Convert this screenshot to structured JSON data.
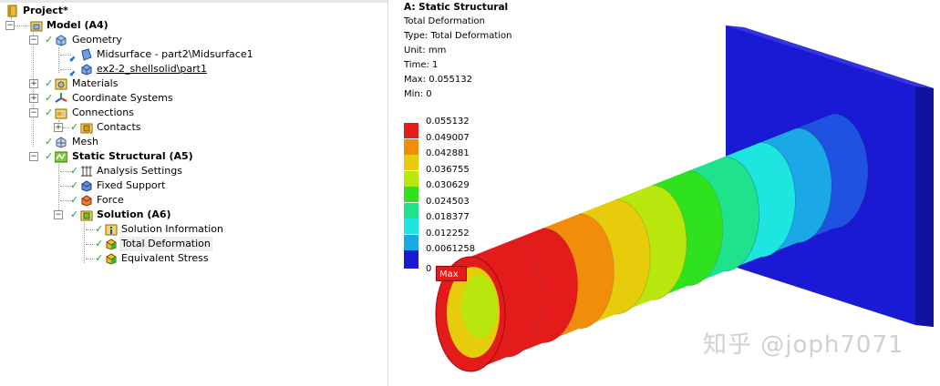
{
  "tree": {
    "project": "Project*",
    "model": "Model (A4)",
    "geometry": "Geometry",
    "midsurface": "Midsurface - part2\\Midsurface1",
    "part": "ex2-2_shellsolid\\part1",
    "materials": "Materials",
    "coordinate_systems": "Coordinate Systems",
    "connections": "Connections",
    "contacts": "Contacts",
    "mesh": "Mesh",
    "static_structural": "Static Structural (A5)",
    "analysis_settings": "Analysis Settings",
    "fixed_support": "Fixed Support",
    "force": "Force",
    "solution": "Solution (A6)",
    "solution_information": "Solution Information",
    "total_deformation": "Total Deformation",
    "equivalent_stress": "Equivalent Stress",
    "expander_plus": "+",
    "expander_minus": "−",
    "check": "✓"
  },
  "info": {
    "title": "A: Static Structural",
    "result": "Total Deformation",
    "type": "Type: Total Deformation",
    "unit": "Unit: mm",
    "time": "Time: 1",
    "max": "Max: 0.055132",
    "min": "Min: 0"
  },
  "legend": {
    "values": [
      "0.055132",
      "0.049007",
      "0.042881",
      "0.036755",
      "0.030629",
      "0.024503",
      "0.018377",
      "0.012252",
      "0.0061258",
      "0"
    ],
    "colors": [
      "#e41b1b",
      "#f28d0c",
      "#e6cc0a",
      "#b9e60c",
      "#2ee31e",
      "#1fe38c",
      "#1ee5df",
      "#1aa9e6",
      "#1f52e0",
      "#1a1ad4"
    ]
  },
  "max_label": "Max",
  "watermark": "知乎 @joph7071",
  "colors": {
    "plate": "#1a1ad4",
    "check_green": "#23a12d"
  }
}
